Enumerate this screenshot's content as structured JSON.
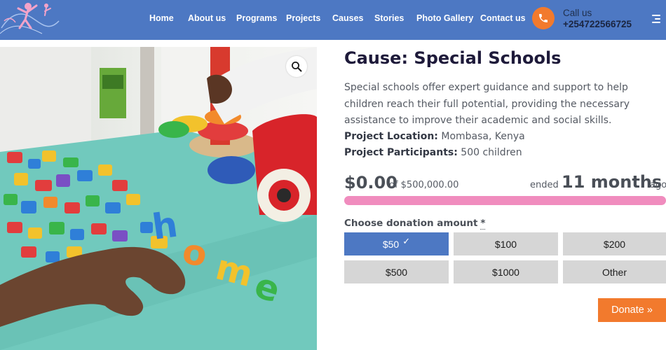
{
  "header": {
    "nav": [
      {
        "label": "Home"
      },
      {
        "label": "About us"
      },
      {
        "label": "Programs"
      },
      {
        "label": "Projects"
      },
      {
        "label": "Causes"
      },
      {
        "label": "Stories"
      },
      {
        "label": "Photo Gallery"
      },
      {
        "label": "Contact us"
      }
    ],
    "call_label": "Call us",
    "call_number": "+254722566725",
    "bg_color": "#4d78c3",
    "call_icon": "phone-icon",
    "menu_icon": "hamburger-menu-icon"
  },
  "cause": {
    "title": "Cause: Special Schools",
    "description": "Special schools offer expert guidance and support to help children reach their full potential, providing the necessary assistance to improve their academic and social skills.",
    "location_label": "Project Location:",
    "location_value": "Mombasa, Kenya",
    "participants_label": "Project Participants:",
    "participants_value": "500 children",
    "raised": "$0.00",
    "goal_text": "of $500,000.00",
    "ended_prefix": "ended",
    "ended_value": "11 months",
    "ended_suffix": "ago",
    "progress_percent": 0,
    "progress_color": "#f08cbe",
    "zoom_icon": "magnifier-icon"
  },
  "donation": {
    "label": "Choose donation amount",
    "required_mark": "*",
    "amounts": [
      {
        "label": "$50",
        "selected": true
      },
      {
        "label": "$100",
        "selected": false
      },
      {
        "label": "$200",
        "selected": false
      },
      {
        "label": "$500",
        "selected": false
      },
      {
        "label": "$1000",
        "selected": false
      },
      {
        "label": "Other",
        "selected": false
      }
    ],
    "selected_check": "✓",
    "button_label": "Donate »",
    "accent": "#f27a2d"
  }
}
